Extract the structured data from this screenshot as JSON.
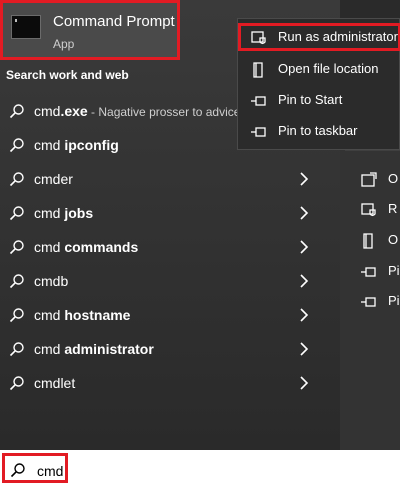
{
  "best_match": {
    "title": "Command Prompt",
    "subtitle": "App"
  },
  "section_header": "Search work and web",
  "results": [
    {
      "prefix": "cmd",
      "bold": ".exe",
      "desc": " - Nagative prosser to advice"
    },
    {
      "prefix": "cmd ",
      "bold": "ipconfig",
      "desc": ""
    },
    {
      "prefix": "cmder",
      "bold": "",
      "desc": ""
    },
    {
      "prefix": "cmd ",
      "bold": "jobs",
      "desc": ""
    },
    {
      "prefix": "cmd ",
      "bold": "commands",
      "desc": ""
    },
    {
      "prefix": "cmdb",
      "bold": "",
      "desc": ""
    },
    {
      "prefix": "cmd ",
      "bold": "hostname",
      "desc": ""
    },
    {
      "prefix": "cmd ",
      "bold": "administrator",
      "desc": ""
    },
    {
      "prefix": "cmdlet",
      "bold": "",
      "desc": ""
    }
  ],
  "context_menu": {
    "items": [
      {
        "label": "Run as administrator",
        "icon": "shield-icon"
      },
      {
        "label": "Open file location",
        "icon": "file-location-icon"
      },
      {
        "label": "Pin to Start",
        "icon": "pin-icon"
      },
      {
        "label": "Pin to taskbar",
        "icon": "pin-icon"
      }
    ]
  },
  "detail_actions": [
    {
      "label": "O",
      "icon": "open-icon"
    },
    {
      "label": "R",
      "icon": "shield-icon"
    },
    {
      "label": "O",
      "icon": "file-location-icon"
    },
    {
      "label": "Pi",
      "icon": "pin-icon"
    },
    {
      "label": "Pi",
      "icon": "pin-icon"
    }
  ],
  "search": {
    "value": "cmd"
  },
  "colors": {
    "highlight_border": "#e21b23",
    "panel_bg": "#2b2b2b",
    "best_match_bg": "#4a4a4a"
  }
}
